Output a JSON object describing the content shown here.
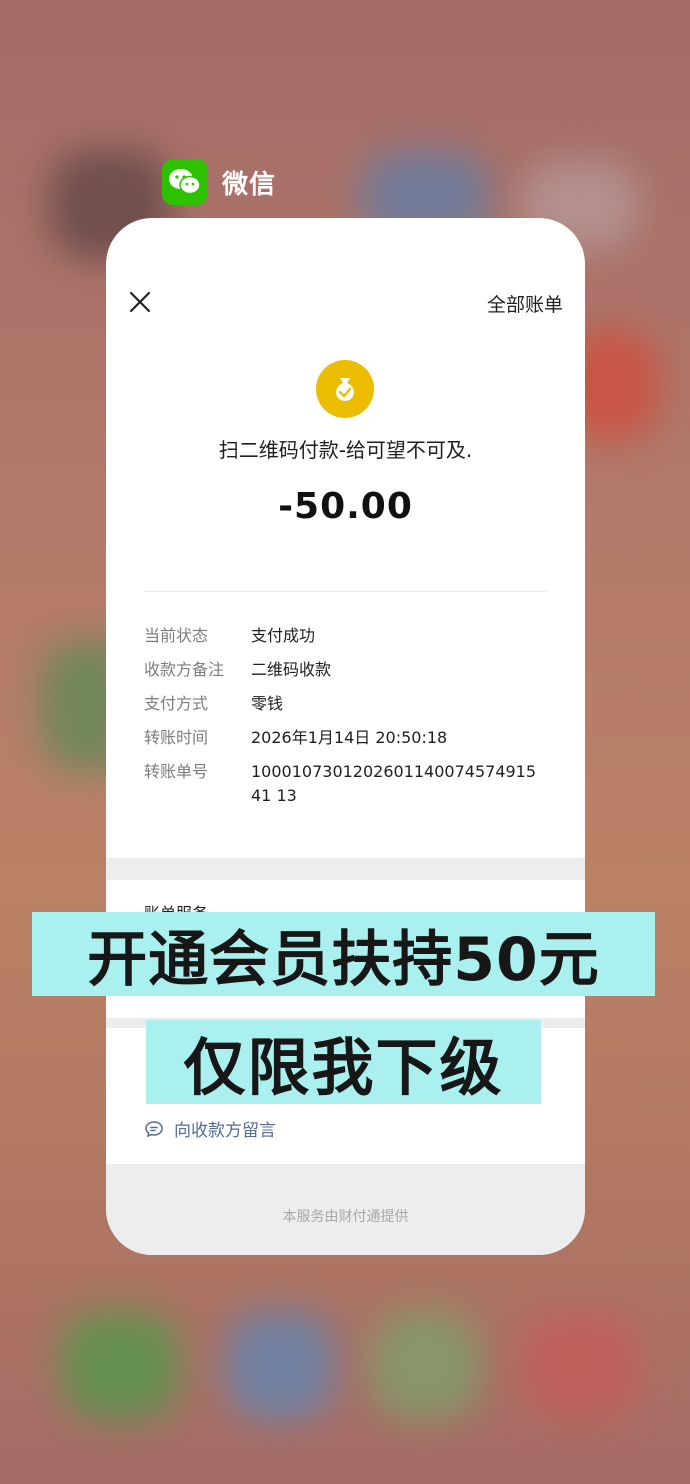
{
  "app": {
    "name": "微信",
    "icon": "wechat-icon",
    "brand_color": "#2dc100"
  },
  "header": {
    "all_bills_label": "全部账单",
    "close_icon": "close-icon"
  },
  "payment": {
    "icon": "money-bag-icon",
    "icon_color": "#ecbc00",
    "merchant": "扫二维码付款-给可望不可及.",
    "amount": "-50.00"
  },
  "details": [
    {
      "label": "当前状态",
      "value": "支付成功"
    },
    {
      "label": "收款方备注",
      "value": "二维码收款"
    },
    {
      "label": "支付方式",
      "value": "零钱"
    },
    {
      "label": "转账时间",
      "value": "2026年1月14日 20:50:18"
    },
    {
      "label": "转账单号",
      "value": "100010730120260114007457491541 13"
    }
  ],
  "services": {
    "title": "账单服务",
    "help_hint": "",
    "message_link": "向收款方留言",
    "message_icon": "chat-bubble-icon",
    "link_color": "#576b95"
  },
  "footer": {
    "provider_text": "本服务由财付通提供"
  },
  "overlay": {
    "line1": "开通会员扶持50元",
    "line2": "仅限我下级",
    "background": "#a9f0ee"
  }
}
